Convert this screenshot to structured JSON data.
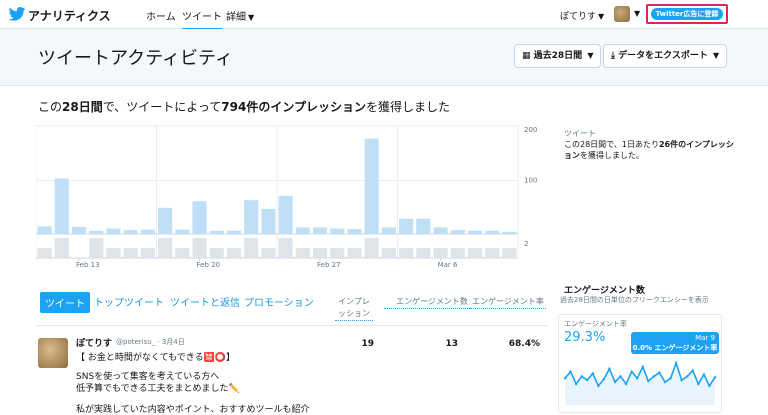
{
  "topbar": {
    "brand": "アナリティクス",
    "nav": [
      "ホーム",
      "ツイート",
      "詳細"
    ],
    "user": "ぽてりす",
    "ads_button": "Twitter広告に登録"
  },
  "header": {
    "title": "ツイートアクティビティ",
    "period_button": "過去28日間",
    "export_button": "データをエクスポート"
  },
  "summary": {
    "prefix": "この",
    "days": "28日間",
    "middle": "で、ツイートによって",
    "impressions": "794件のインプレッション",
    "suffix": "を獲得しました"
  },
  "chart_data": {
    "type": "bar",
    "x_ticks": [
      "Feb 13",
      "Feb 20",
      "Feb 27",
      "Mar 6"
    ],
    "y_ticks_top": [
      "200",
      "100"
    ],
    "y_ticks_bottom": [
      "2"
    ],
    "series": [
      {
        "values": [
          14,
          102,
          13,
          6,
          10,
          7,
          8,
          48,
          8,
          60,
          6,
          6,
          62,
          46,
          70,
          12,
          12,
          10,
          9,
          175,
          12,
          28,
          28,
          12,
          7,
          6,
          6,
          4
        ]
      },
      {
        "values": [
          1,
          2,
          0,
          2,
          1,
          1,
          1,
          2,
          1,
          2,
          1,
          1,
          2,
          1,
          2,
          1,
          1,
          1,
          1,
          2,
          1,
          1,
          1,
          1,
          1,
          1,
          1,
          1
        ]
      }
    ],
    "ylim": [
      0,
      200
    ]
  },
  "side_info": {
    "label": "ツイート",
    "text_1": "この28日間で、1日あたり",
    "text_bold": "26件のインプレッション",
    "text_2": "を獲得しました。"
  },
  "tabs": [
    "ツイート",
    "トップツイート",
    "ツイートと返信",
    "プロモーション"
  ],
  "columns": [
    "インプレッション",
    "エンゲージメント数",
    "エンゲージメント率"
  ],
  "tweet": {
    "name": "ぽてりす",
    "handle": "@poterisu_ · 3月4日",
    "lines": [
      "【 お金と時間がなくてもできる🈲⭕】",
      "SNSを使って集客を考えている方へ",
      "低予算でもできる工夫をまとめました✏️",
      "私が実践していた内容やポイント、おすすめツールも紹介"
    ],
    "impressions": "19",
    "engagements": "13",
    "rate": "68.4%"
  },
  "engagement_card": {
    "title": "エンゲージメント数",
    "subtitle": "過去28日間の日単位のフリークエンシーを表示",
    "rate_label": "エンゲージメント率",
    "rate_value": "29.3%",
    "tooltip_date": "Mar 9",
    "tooltip_text": "0.0% エンゲージメント率",
    "trend": [
      28,
      35,
      22,
      30,
      26,
      33,
      20,
      27,
      38,
      24,
      30,
      22,
      35,
      28,
      40,
      25,
      30,
      34,
      24,
      28,
      44,
      26,
      30,
      36,
      22,
      32,
      20,
      29
    ]
  },
  "colors": {
    "accent": "#1da1f2",
    "bar": "#bfdff7",
    "bar_low": "#dfe4e8",
    "highlight": "#e0245e"
  }
}
